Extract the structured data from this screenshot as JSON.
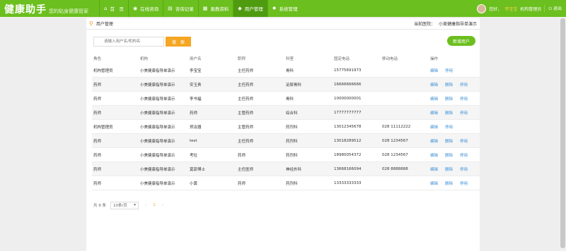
{
  "header": {
    "title": "健康助手",
    "subtitle": "您的贴身健康管家",
    "nav": [
      {
        "icon": "⌂",
        "label": "首　页"
      },
      {
        "icon": "◉",
        "label": "在线咨询"
      },
      {
        "icon": "▤",
        "label": "咨询记录"
      },
      {
        "icon": "▦",
        "label": "患教资料"
      },
      {
        "icon": "◆",
        "label": "用户管理"
      },
      {
        "icon": "✹",
        "label": "系统管理"
      }
    ],
    "greeting": "您好，",
    "user_name": "李宝宝",
    "user_role": "机构管理员",
    "logout_icon": "⏻",
    "logout_label": "退出"
  },
  "breadcrumb": {
    "label": "用户管理",
    "hospital_label": "当前医院：",
    "hospital_name": "小美健康指导单演示"
  },
  "search": {
    "placeholder": "请输入用户名/机构名",
    "button_label": "搜　索",
    "add_user_label": "新增用户"
  },
  "table": {
    "headers": [
      "角色",
      "机构",
      "用户名",
      "职称",
      "科室",
      "固定电话",
      "移动电话",
      "操作"
    ],
    "rows": [
      {
        "role": "机构管理员",
        "org": "小美健康指导单演示",
        "user": "李宝宝",
        "title": "主任药师",
        "dept": "骨科",
        "phone": "15775691973",
        "mobile": "",
        "actions": [
          "编辑",
          "停用"
        ]
      },
      {
        "role": "药师",
        "org": "小美健康指导单演示",
        "user": "安玉贵",
        "title": "主任药师",
        "dept": "泌尿骨科",
        "phone": "16666666666",
        "mobile": "",
        "actions": [
          "编辑",
          "删除",
          "停用"
        ]
      },
      {
        "role": "药师",
        "org": "小美健康指导单演示",
        "user": "李书福",
        "title": "主任药师",
        "dept": "骨科",
        "phone": "10000000001",
        "mobile": "",
        "actions": [
          "编辑",
          "删除",
          "停用"
        ]
      },
      {
        "role": "药师",
        "org": "小美健康指导单演示",
        "user": "药师",
        "title": "主管药师",
        "dept": "综合科",
        "phone": "17777777777",
        "mobile": "",
        "actions": [
          "编辑",
          "删除",
          "停用"
        ]
      },
      {
        "role": "机构管理员",
        "org": "小美健康指导单演示",
        "user": "郑汝器",
        "title": "主管药师",
        "dept": "药剂科",
        "phone": "13012345678",
        "mobile": "028 11112222",
        "actions": [
          "编辑",
          "停用"
        ]
      },
      {
        "role": "药师",
        "org": "小美健康指导单演示",
        "user": "test",
        "title": "主任药师",
        "dept": "药剂科",
        "phone": "13018289512",
        "mobile": "028 1234567",
        "actions": [
          "编辑",
          "删除",
          "停用"
        ]
      },
      {
        "role": "药师",
        "org": "小美健康指导单演示",
        "user": "考拉",
        "title": "药师",
        "dept": "药剂科",
        "phone": "18980054372",
        "mobile": "028 1234567",
        "actions": [
          "编辑",
          "删除",
          "停用"
        ]
      },
      {
        "role": "药师",
        "org": "小美健康指导单演示",
        "user": "莫郭博士",
        "title": "主任医师",
        "dept": "神经外科",
        "phone": "13668166094",
        "mobile": "028 8888888",
        "actions": [
          "编辑",
          "删除",
          "停用"
        ]
      },
      {
        "role": "药师",
        "org": "小美健康指导单演示",
        "user": "小黄",
        "title": "药师",
        "dept": "药剂科",
        "phone": "13333333333",
        "mobile": "",
        "actions": [
          "编辑",
          "删除",
          "停用"
        ]
      }
    ]
  },
  "pager": {
    "total": "共 9 条",
    "page_size": "10条/页",
    "prev": "‹",
    "current": "1",
    "next": "›"
  }
}
